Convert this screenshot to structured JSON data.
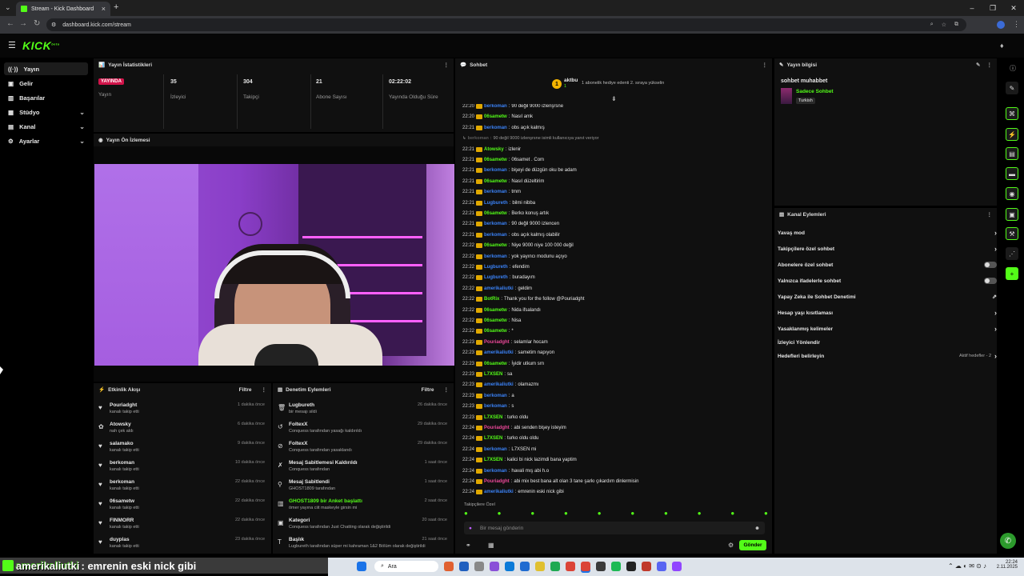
{
  "browser": {
    "tab_title": "Stream - Kick Dashboard",
    "url": "dashboard.kick.com/stream"
  },
  "brand": {
    "logo": "KICK",
    "logo_sup": "beta",
    "accent": "#53fc18"
  },
  "sidebar": {
    "items": [
      {
        "label": "Yayın",
        "icon": "broadcast-icon"
      },
      {
        "label": "Gelir",
        "icon": "dollar-icon"
      },
      {
        "label": "Başarılar",
        "icon": "trophy-icon"
      },
      {
        "label": "Stüdyo",
        "icon": "studio-icon"
      },
      {
        "label": "Kanal",
        "icon": "channel-icon"
      },
      {
        "label": "Ayarlar",
        "icon": "gear-icon"
      }
    ]
  },
  "stats": {
    "title": "Yayın İstatistikleri",
    "live_badge": "YAYINDA",
    "live_label": "Yayın",
    "items": [
      {
        "value": "35",
        "label": "İzleyici"
      },
      {
        "value": "304",
        "label": "Takipçi"
      },
      {
        "value": "21",
        "label": "Abone Sayısı"
      },
      {
        "value": "02:22:02",
        "label": "Yayında Olduğu Süre"
      }
    ]
  },
  "preview": {
    "title": "Yayın Ön İzlemesi"
  },
  "activity": {
    "title": "Etkinlik Akışı",
    "filter": "Filtre",
    "items": [
      {
        "name": "Pouriadght",
        "desc": "kanalı takip etti",
        "time": "1 dakika önce"
      },
      {
        "name": "Atowsky",
        "desc": "nah çek aldı",
        "time": "6 dakika önce"
      },
      {
        "name": "salamako",
        "desc": "kanalı takip etti",
        "time": "9 dakika önce"
      },
      {
        "name": "berkoman",
        "desc": "kanalı takip etti",
        "time": "10 dakika önce"
      },
      {
        "name": "berkoman",
        "desc": "kanalı takip etti",
        "time": "22 dakika önce"
      },
      {
        "name": "06sametw",
        "desc": "kanalı takip etti",
        "time": "22 dakika önce"
      },
      {
        "name": "FINMORR",
        "desc": "kanalı takip etti",
        "time": "22 dakika önce"
      },
      {
        "name": "duyplas",
        "desc": "kanalı takip etti",
        "time": "23 dakika önce"
      }
    ]
  },
  "moderation": {
    "title": "Denetim Eylemleri",
    "filter": "Filtre",
    "items": [
      {
        "name": "Lugbureth",
        "desc": "bir mesajı sildi",
        "time": "26 dakika önce"
      },
      {
        "name": "FoltexX",
        "desc": "Conquess tarafından yasağı kaldırıldı",
        "time": "29 dakika önce"
      },
      {
        "name": "FoltexX",
        "desc": "Conquess tarafından yasaklandı",
        "time": "29 dakika önce"
      },
      {
        "name": "Mesaj Sabitlemesi Kaldırıldı",
        "desc": "Conquess tarafından",
        "time": "1 saat önce"
      },
      {
        "name": "Mesaj Sabitlendi",
        "desc": "GHOST1809 tarafından",
        "time": "1 saat önce"
      },
      {
        "name": "GHOST1809 bir Anket başlattı",
        "desc": "ömer yayına ciit maskeyle girsin mi",
        "time": "2 saat önce"
      },
      {
        "name": "Kategori",
        "desc": "Conquess tarafından Just Chatting olarak değiştirildi",
        "time": "20 saat önce"
      },
      {
        "name": "Başlık",
        "desc": "Lugbureth tarafından süper mi kahraman 1&2 Bölüm olarak değiştirildi",
        "time": "21 saat önce"
      }
    ]
  },
  "chat": {
    "title": "Sohbet",
    "top_user": "aktbu",
    "top_user_count": "1",
    "gift_note": "1 abonelik hediye edenti 2. sıraya yükselin",
    "followers_only": "Takipçilere Özel",
    "input_placeholder": "Bir mesaj gönderin",
    "send": "Gönder",
    "messages": [
      {
        "time": "22:20",
        "user": "berkoman",
        "color": "#3b82f6",
        "text": "90 değil 9000 izlenşrsne"
      },
      {
        "time": "22:20",
        "user": "06sametw",
        "color": "#53fc18",
        "text": "Nasıl amk"
      },
      {
        "time": "22:21",
        "user": "berkoman",
        "color": "#3b82f6",
        "text": "obs açık kalmış"
      },
      {
        "time": "",
        "user": "berkoman",
        "color": "#888",
        "text": "90 değil 9000 izlenşrsne isimli kullanıcıya yanıt veriyor"
      },
      {
        "time": "22:21",
        "user": "Atowsky",
        "color": "#53fc18",
        "text": "izlenir"
      },
      {
        "time": "22:21",
        "user": "06sametw",
        "color": "#53fc18",
        "text": "06samet . Com"
      },
      {
        "time": "22:21",
        "user": "berkoman",
        "color": "#3b82f6",
        "text": "bişeyi de düzgün oku be adam"
      },
      {
        "time": "22:21",
        "user": "06sametw",
        "color": "#53fc18",
        "text": "Nasıl düzeltirim"
      },
      {
        "time": "22:21",
        "user": "berkoman",
        "color": "#3b82f6",
        "text": "tmm"
      },
      {
        "time": "22:21",
        "user": "Lugbureth",
        "color": "#3b82f6",
        "text": "bilmi nibba"
      },
      {
        "time": "22:21",
        "user": "06sametw",
        "color": "#53fc18",
        "text": "Berko konuş artık"
      },
      {
        "time": "22:21",
        "user": "berkoman",
        "color": "#3b82f6",
        "text": "90 değil 9000 izlencen"
      },
      {
        "time": "22:21",
        "user": "berkoman",
        "color": "#3b82f6",
        "text": "obs açık kalmış olabilir"
      },
      {
        "time": "22:22",
        "user": "06sametw",
        "color": "#53fc18",
        "text": "Niye 9000 niye 100 000 değil"
      },
      {
        "time": "22:22",
        "user": "berkoman",
        "color": "#3b82f6",
        "text": "yok yayıncı modunu açıyo"
      },
      {
        "time": "22:22",
        "user": "Lugbureth",
        "color": "#3b82f6",
        "text": "efendim"
      },
      {
        "time": "22:22",
        "user": "Lugbureth",
        "color": "#3b82f6",
        "text": "buradayım"
      },
      {
        "time": "22:22",
        "user": "amerikaliutki",
        "color": "#3b82f6",
        "text": "geldim"
      },
      {
        "time": "22:22",
        "user": "BotRix",
        "color": "#53fc18",
        "text": "Thank you for the follow @Pouriadght"
      },
      {
        "time": "22:22",
        "user": "06sametw",
        "color": "#53fc18",
        "text": "Nida ifsalandı"
      },
      {
        "time": "22:22",
        "user": "06sametw",
        "color": "#53fc18",
        "text": "Nisa"
      },
      {
        "time": "22:22",
        "user": "06sametw",
        "color": "#53fc18",
        "text": "*"
      },
      {
        "time": "22:23",
        "user": "Pouriadght",
        "color": "#ec4899",
        "text": "selamlar hocam"
      },
      {
        "time": "22:23",
        "user": "amerikaliutki",
        "color": "#3b82f6",
        "text": "sametim napıyon"
      },
      {
        "time": "22:23",
        "user": "06sametw",
        "color": "#53fc18",
        "text": "İyidir utkum srn"
      },
      {
        "time": "22:23",
        "user": "L7XSEN",
        "color": "#53fc18",
        "text": "sa"
      },
      {
        "time": "22:23",
        "user": "amerikaliutki",
        "color": "#3b82f6",
        "text": "olamazmı"
      },
      {
        "time": "22:23",
        "user": "berkoman",
        "color": "#3b82f6",
        "text": "a"
      },
      {
        "time": "22:23",
        "user": "berkoman",
        "color": "#3b82f6",
        "text": "s"
      },
      {
        "time": "22:23",
        "user": "L7XSEN",
        "color": "#53fc18",
        "text": "turko oldu"
      },
      {
        "time": "22:24",
        "user": "Pouriadght",
        "color": "#ec4899",
        "text": "abi senden bişey isteyim"
      },
      {
        "time": "22:24",
        "user": "L7XSEN",
        "color": "#53fc18",
        "text": "turko oldu oldu"
      },
      {
        "time": "22:24",
        "user": "berkoman",
        "color": "#3b82f6",
        "text": "L7XSEN mi"
      },
      {
        "time": "22:24",
        "user": "L7XSEN",
        "color": "#53fc18",
        "text": "kalici bi nick lazimdi bana yaptim"
      },
      {
        "time": "22:24",
        "user": "berkoman",
        "color": "#3b82f6",
        "text": "havali mış abi h.o"
      },
      {
        "time": "22:24",
        "user": "Pouriadght",
        "color": "#ec4899",
        "text": "abi mix best bana alt olan 3 tane şarkı çıkardım dinlermisin"
      },
      {
        "time": "22:24",
        "user": "amerikaliutki",
        "color": "#3b82f6",
        "text": "emrenin eski nick gibi"
      }
    ]
  },
  "stream_info": {
    "title": "Yayın bilgisi",
    "stream_title": "sohbet muhabbet",
    "category": "Sadece Sohbet",
    "tag": "Turkish"
  },
  "channel_actions": {
    "title": "Kanal Eylemleri",
    "items": [
      {
        "label": "Yavaş mod",
        "kind": "arrow"
      },
      {
        "label": "Takipçilere özel sohbet",
        "kind": "arrow"
      },
      {
        "label": "Abonelere özel sohbet",
        "kind": "toggle"
      },
      {
        "label": "Yalnızca ifadelerle sohbet",
        "kind": "toggle"
      },
      {
        "label": "Yapay Zeka ile Sohbet Denetimi",
        "kind": "external"
      },
      {
        "label": "Hesap yaşı kısıtlaması",
        "kind": "arrow"
      },
      {
        "label": "Yasaklanmış kelimeler",
        "kind": "arrow"
      },
      {
        "label": "İzleyici Yönlendir",
        "kind": "none"
      },
      {
        "label": "Hedefleri belirleyin",
        "kind": "goal"
      }
    ],
    "goal_note": "Aktif hedefler - 2"
  },
  "overlay": {
    "user": "amerikaliutki",
    "text": ": emrenin eski nick gibi"
  },
  "taskbar": {
    "search": "Ara",
    "time": "22:24",
    "date": "2.11.2025"
  }
}
